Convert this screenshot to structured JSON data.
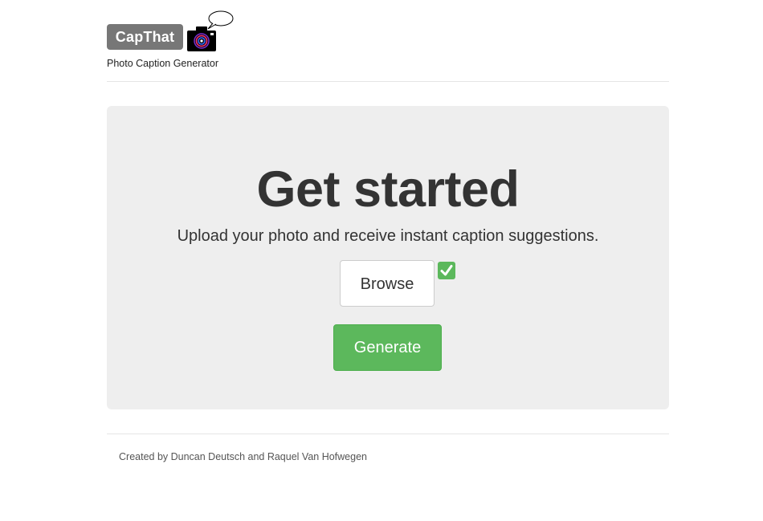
{
  "header": {
    "brand": "CapThat",
    "tagline": "Photo Caption Generator",
    "logo_icon": "camera-with-speech-bubble-icon"
  },
  "main": {
    "title": "Get started",
    "lead": "Upload your photo and receive instant caption suggestions.",
    "browse_label": "Browse",
    "browse_status_icon": "checkmark-icon",
    "generate_label": "Generate"
  },
  "footer": {
    "credit": "Created by Duncan Deutsch and Raquel Van Hofwegen"
  },
  "colors": {
    "brand_badge": "#777777",
    "jumbotron_bg": "#eeeeee",
    "success": "#5cb85c"
  }
}
